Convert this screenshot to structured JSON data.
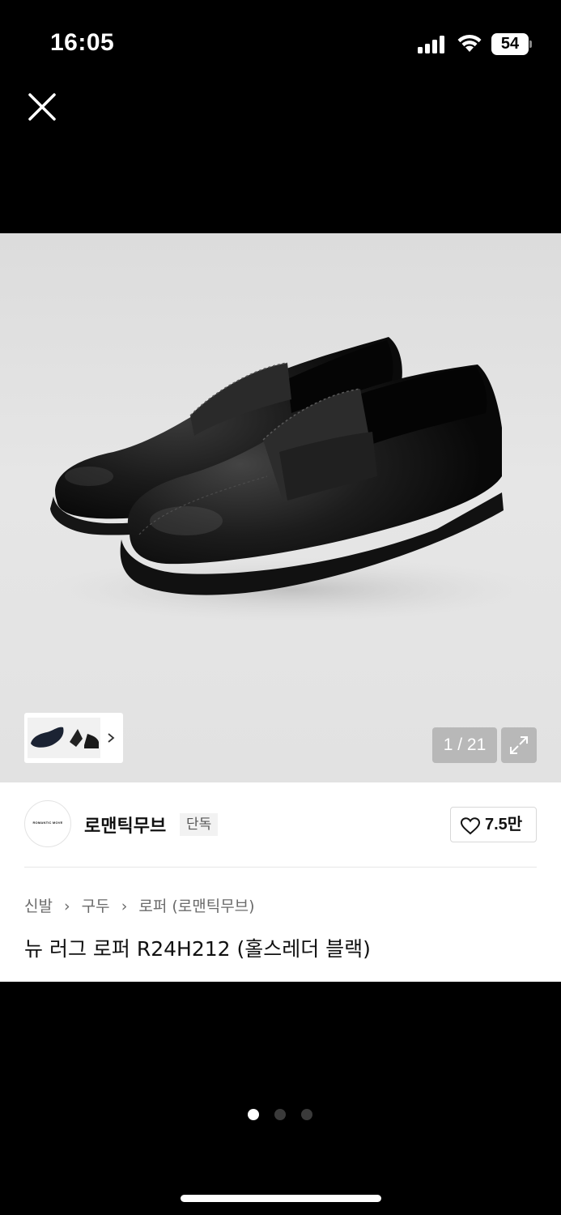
{
  "status_bar": {
    "time": "16:05",
    "battery": "54"
  },
  "gallery": {
    "counter": "1 / 21"
  },
  "brand": {
    "logo_text": "ROMANTIC MOVE",
    "name": "로맨틱무브",
    "badge": "단독"
  },
  "like": {
    "count": "7.5만"
  },
  "breadcrumb": [
    "신발",
    "구두",
    "로퍼 (로맨틱무브)"
  ],
  "product": {
    "title": "뉴 러그 로퍼 R24H212 (홀스레더 블랙)"
  },
  "pager": {
    "active_index": 0,
    "total": 3
  },
  "colors": {
    "background": "#000000",
    "photo_bg": "#e2e2e2",
    "text_primary": "#111111",
    "text_secondary": "#6b6b6b"
  }
}
